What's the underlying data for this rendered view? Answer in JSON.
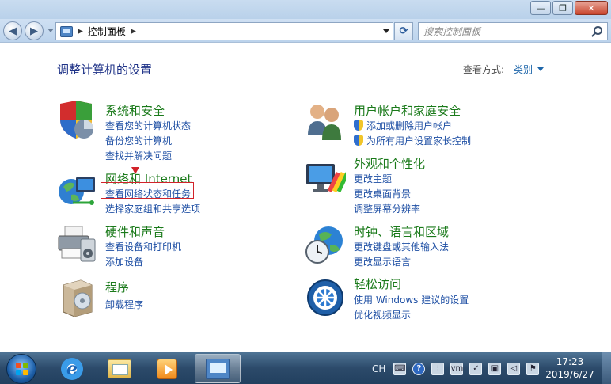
{
  "window": {
    "buttons": {
      "minimize": "—",
      "maximize": "❐",
      "close": "✕"
    }
  },
  "address": {
    "crumb": "控制面板",
    "search_placeholder": "搜索控制面板"
  },
  "header": {
    "title": "调整计算机的设置",
    "view_label": "查看方式:",
    "view_value": "类别"
  },
  "categories": [
    {
      "title": "系统和安全",
      "links": [
        "查看您的计算机状态",
        "备份您的计算机",
        "查找并解决问题"
      ]
    },
    {
      "title": "网络和 Internet",
      "links": [
        "查看网络状态和任务",
        "选择家庭组和共享选项"
      ]
    },
    {
      "title": "硬件和声音",
      "links": [
        "查看设备和打印机",
        "添加设备"
      ]
    },
    {
      "title": "程序",
      "links": [
        "卸载程序"
      ]
    },
    {
      "title": "用户帐户和家庭安全",
      "links": [
        "添加或删除用户帐户",
        "为所有用户设置家长控制"
      ]
    },
    {
      "title": "外观和个性化",
      "links": [
        "更改主题",
        "更改桌面背景",
        "调整屏幕分辨率"
      ]
    },
    {
      "title": "时钟、语言和区域",
      "links": [
        "更改键盘或其他输入法",
        "更改显示语言"
      ]
    },
    {
      "title": "轻松访问",
      "links": [
        "使用 Windows 建议的设置",
        "优化视频显示"
      ]
    }
  ],
  "taskbar": {
    "tray_lang": "CH",
    "time": "17:23",
    "date": "2019/6/27"
  },
  "icons": {
    "system": "shield-chart-icon",
    "network": "globe-network-icon",
    "hardware": "printer-icon",
    "programs": "programs-box-icon",
    "users": "users-icon",
    "appearance": "monitor-palette-icon",
    "clock": "clock-globe-icon",
    "access": "ease-of-access-icon"
  }
}
